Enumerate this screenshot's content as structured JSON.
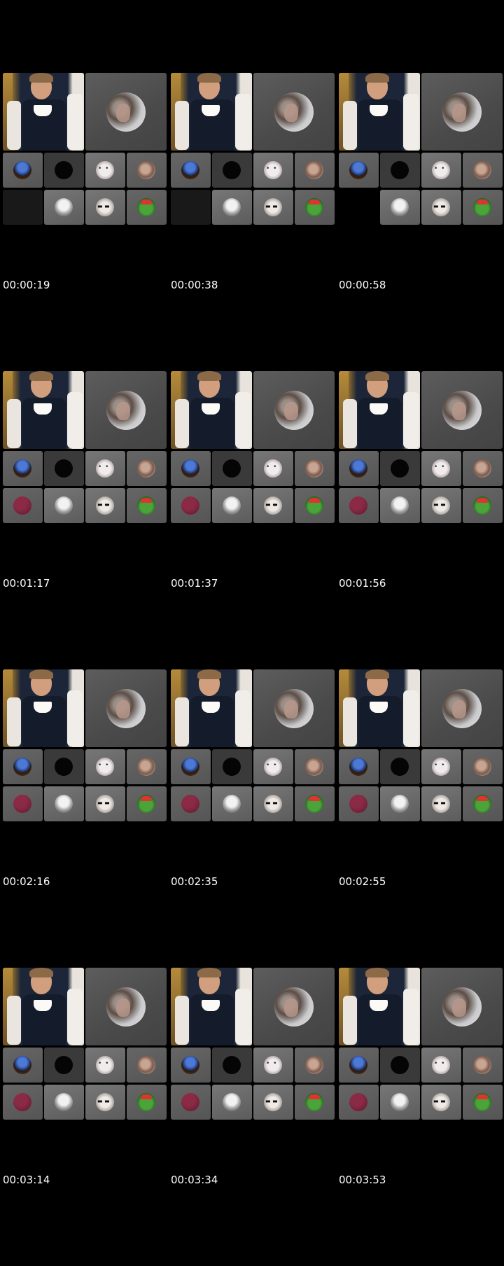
{
  "timestamps": [
    "00:00:19",
    "00:00:38",
    "00:00:58",
    "00:01:17",
    "00:01:37",
    "00:01:56",
    "00:02:16",
    "00:02:35",
    "00:02:55",
    "00:03:14",
    "00:03:34",
    "00:03:53"
  ],
  "participants": {
    "speaker": "man-holding-cup-photo",
    "small_tiles": [
      "planet-avatar",
      "black-circle-avatar",
      "cat-avatar",
      "monkey-avatar",
      "maroon-circle-avatar",
      "ghost-avatar",
      "sunglasses-avatar",
      "frog-avatar"
    ]
  },
  "colors": {
    "background": "#000000",
    "tile": "#555555",
    "text": "#ffffff"
  }
}
